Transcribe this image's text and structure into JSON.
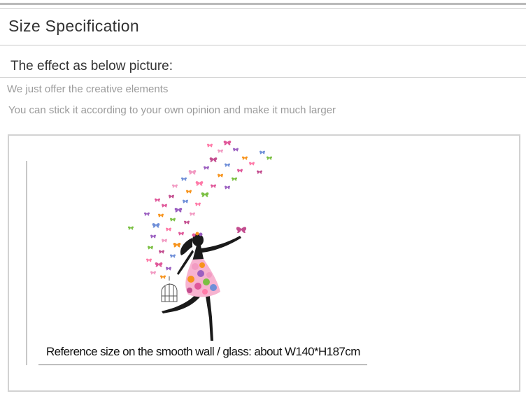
{
  "header": {
    "title": "Size Specification"
  },
  "section": {
    "subtitle": "The effect as below picture:",
    "lines": [
      "We just offer the creative elements",
      "You can stick it according to your own opinion and make it much larger"
    ]
  },
  "figure": {
    "caption": "Reference size on the smooth wall / glass: about W140*H187cm"
  },
  "colors": {
    "butterflies": [
      "#e0589a",
      "#9b5fc0",
      "#f29bc3",
      "#f7941d",
      "#7bc043",
      "#c34d8f",
      "#6f8fd8",
      "#ff7aa8"
    ],
    "silhouette": "#1a1a1a"
  }
}
